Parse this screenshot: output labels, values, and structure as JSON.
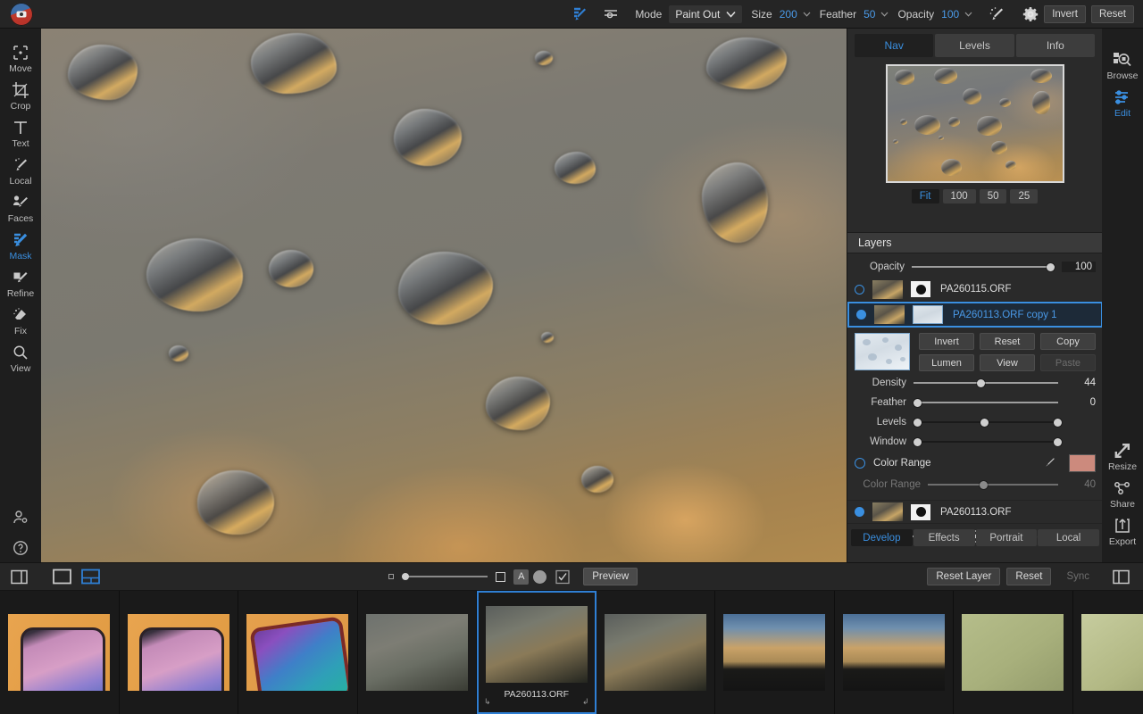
{
  "app": {
    "logo_name": "app-logo"
  },
  "toolbar": {
    "tools": [
      {
        "name": "mask-brush-tool",
        "active": true
      },
      {
        "name": "gradient-mask-tool",
        "active": false
      }
    ],
    "mode_label": "Mode",
    "mode_value": "Paint Out",
    "size_label": "Size",
    "size_value": "200",
    "feather_label": "Feather",
    "feather_value": "50",
    "opacity_label": "Opacity",
    "opacity_value": "100",
    "magic_wand_icon": "magic-wand-icon",
    "settings_icon": "gear-icon",
    "invert_label": "Invert",
    "reset_label": "Reset"
  },
  "left_rail": {
    "items": [
      {
        "label": "Move",
        "icon": "move-icon",
        "active": false
      },
      {
        "label": "Crop",
        "icon": "crop-icon",
        "active": false
      },
      {
        "label": "Text",
        "icon": "text-icon",
        "active": false
      },
      {
        "label": "Local",
        "icon": "local-brush-icon",
        "active": false
      },
      {
        "label": "Faces",
        "icon": "faces-icon",
        "active": false
      },
      {
        "label": "Mask",
        "icon": "mask-icon",
        "active": true
      },
      {
        "label": "Refine",
        "icon": "refine-icon",
        "active": false
      },
      {
        "label": "Fix",
        "icon": "fix-eraser-icon",
        "active": false
      },
      {
        "label": "View",
        "icon": "view-magnifier-icon",
        "active": false
      }
    ],
    "bottom": [
      {
        "name": "account-icon"
      },
      {
        "name": "help-icon"
      }
    ]
  },
  "right_rail": {
    "top": [
      {
        "label": "Browse",
        "icon": "browse-icon",
        "active": false
      },
      {
        "label": "Edit",
        "icon": "edit-sliders-icon",
        "active": true
      }
    ],
    "bottom": [
      {
        "label": "Resize",
        "icon": "resize-icon"
      },
      {
        "label": "Share",
        "icon": "share-icon"
      },
      {
        "label": "Export",
        "icon": "export-icon"
      }
    ]
  },
  "nav_panel": {
    "tabs": [
      {
        "label": "Nav",
        "active": true
      },
      {
        "label": "Levels",
        "active": false
      },
      {
        "label": "Info",
        "active": false
      }
    ],
    "zoom_levels": [
      {
        "label": "Fit",
        "active": true
      },
      {
        "label": "100",
        "active": false
      },
      {
        "label": "50",
        "active": false
      },
      {
        "label": "25",
        "active": false
      }
    ]
  },
  "layers_panel": {
    "title": "Layers",
    "opacity_label": "Opacity",
    "opacity_value": "100",
    "opacity_percent": 100,
    "layers": [
      {
        "name": "PA260115.ORF",
        "visible": false,
        "selected": false,
        "has_mask_icon": true,
        "has_mask_thumb": false
      },
      {
        "name": "PA260113.ORF copy 1",
        "visible": true,
        "selected": true,
        "has_mask_icon": false,
        "has_mask_thumb": true
      },
      {
        "name": "PA260113.ORF",
        "visible": true,
        "selected": false,
        "has_mask_icon": true,
        "has_mask_thumb": false
      }
    ],
    "mask_buttons": [
      {
        "label": "Invert",
        "disabled": false
      },
      {
        "label": "Reset",
        "disabled": false
      },
      {
        "label": "Copy",
        "disabled": false
      },
      {
        "label": "Lumen",
        "disabled": false
      },
      {
        "label": "View",
        "disabled": false
      },
      {
        "label": "Paste",
        "disabled": true
      }
    ],
    "sliders": [
      {
        "label": "Density",
        "value": "44",
        "percent": 44,
        "handles": 1,
        "dimmed": false
      },
      {
        "label": "Feather",
        "value": "0",
        "percent": 0,
        "handles": 1,
        "dimmed": false
      },
      {
        "label": "Levels",
        "value": "",
        "percent": 45,
        "handles": 3,
        "dimmed": false
      },
      {
        "label": "Window",
        "value": "",
        "percent": 0,
        "handles": 2,
        "dimmed": false
      }
    ],
    "color_range": {
      "label": "Color Range",
      "enabled": false,
      "eyedropper_icon": "eyedropper-icon",
      "swatch_color": "#cc8a7d",
      "slider_label": "Color Range",
      "slider_value": "40",
      "slider_percent": 40
    },
    "layer_tools": [
      {
        "name": "add-layer-icon"
      },
      {
        "name": "duplicate-layer-icon"
      },
      {
        "name": "delete-layer-icon"
      },
      {
        "name": "merge-layers-icon"
      },
      {
        "name": "layer-settings-icon"
      }
    ],
    "mode_tabs": [
      {
        "label": "Develop",
        "active": true
      },
      {
        "label": "Effects",
        "active": false
      },
      {
        "label": "Portrait",
        "active": false
      },
      {
        "label": "Local",
        "active": false
      }
    ]
  },
  "control_bar": {
    "left_icons": [
      {
        "name": "show-panel-icon"
      },
      {
        "name": "single-view-icon"
      },
      {
        "name": "compare-view-icon"
      }
    ],
    "zoom_percent": 4,
    "center_icons": [
      {
        "name": "thumbnail-size-small-icon"
      },
      {
        "name": "thumbnail-size-large-icon"
      },
      {
        "name": "rating-label-icon",
        "label": "A"
      },
      {
        "name": "color-label-icon"
      },
      {
        "name": "checkmark-label-icon"
      }
    ],
    "preview_label": "Preview",
    "reset_layer_label": "Reset Layer",
    "reset_label": "Reset",
    "sync_label": "Sync",
    "sync_disabled": true,
    "right_panel_toggle_icon": "toggle-right-panel-icon"
  },
  "filmstrip": {
    "items": [
      {
        "thumb": "phone-screen-1614",
        "name": "",
        "selected": false
      },
      {
        "thumb": "phone-screen-1615",
        "name": "",
        "selected": false
      },
      {
        "thumb": "phone-home-screen",
        "name": "",
        "selected": false
      },
      {
        "thumb": "raindrops-window-1",
        "name": "",
        "selected": false
      },
      {
        "thumb": "raindrops-window-2",
        "name": "PA260113.ORF",
        "selected": true
      },
      {
        "thumb": "raindrops-bokeh",
        "name": "",
        "selected": false
      },
      {
        "thumb": "sunset-clouds-1",
        "name": "",
        "selected": false
      },
      {
        "thumb": "sunset-clouds-2",
        "name": "",
        "selected": false
      },
      {
        "thumb": "code-screen-1",
        "name": "",
        "selected": false
      },
      {
        "thumb": "code-screen-2",
        "name": "",
        "selected": false
      }
    ]
  }
}
